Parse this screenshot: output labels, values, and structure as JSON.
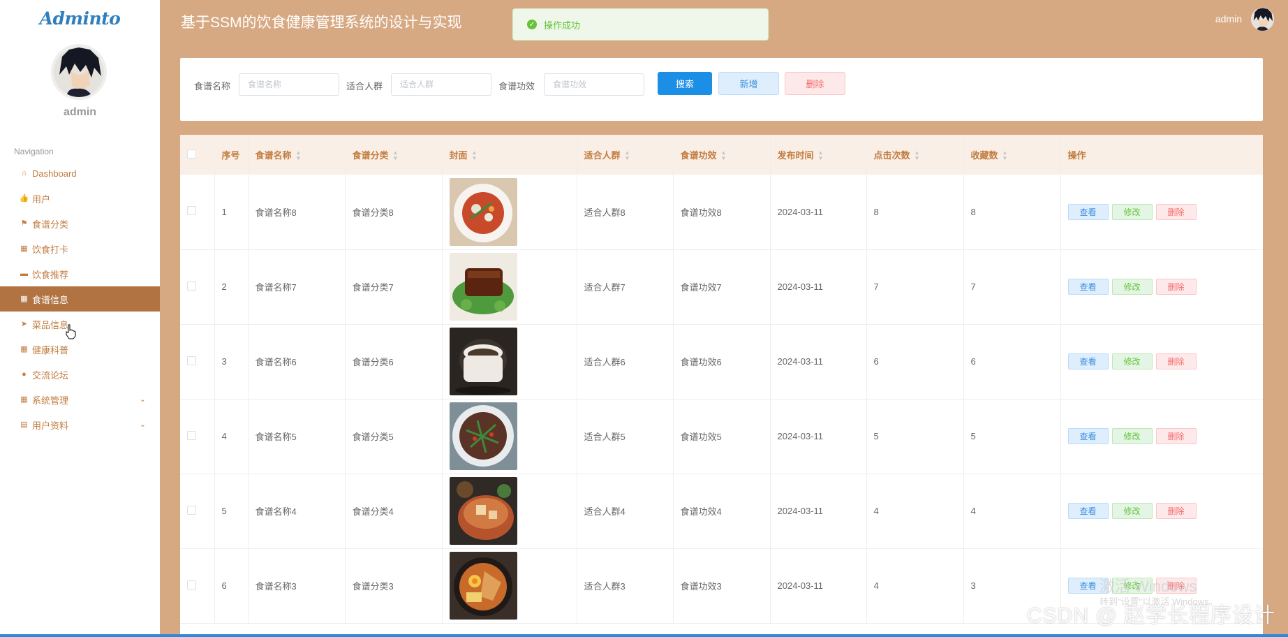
{
  "app": {
    "logo": "Adminto",
    "title": "基于SSM的饮食健康管理系统的设计与实现"
  },
  "sidebar": {
    "username": "admin",
    "nav_title": "Navigation",
    "items": [
      {
        "label": "Dashboard",
        "icon": "home-icon"
      },
      {
        "label": "用户",
        "icon": "thumbs-up-icon"
      },
      {
        "label": "食谱分类",
        "icon": "flag-icon"
      },
      {
        "label": "饮食打卡",
        "icon": "grid-icon"
      },
      {
        "label": "饮食推荐",
        "icon": "comment-icon"
      },
      {
        "label": "食谱信息",
        "icon": "grid-icon"
      },
      {
        "label": "菜品信息",
        "icon": "send-icon"
      },
      {
        "label": "健康科普",
        "icon": "grid-icon"
      },
      {
        "label": "交流论坛",
        "icon": "map-pin-icon"
      },
      {
        "label": "系统管理",
        "icon": "grid-icon"
      },
      {
        "label": "用户资料",
        "icon": "calendar-icon"
      }
    ],
    "active_index": 5
  },
  "toast": {
    "message": "操作成功"
  },
  "topbar": {
    "username": "admin"
  },
  "search": {
    "name_label": "食谱名称",
    "name_placeholder": "食谱名称",
    "crowd_label": "适合人群",
    "crowd_placeholder": "适合人群",
    "effect_label": "食谱功效",
    "effect_placeholder": "食谱功效",
    "search_btn": "搜索",
    "add_btn": "新增",
    "delete_btn": "删除"
  },
  "table": {
    "headers": [
      "序号",
      "食谱名称",
      "食谱分类",
      "封面",
      "适合人群",
      "食谱功效",
      "发布时间",
      "点击次数",
      "收藏数",
      "操作"
    ],
    "actions": {
      "view": "查看",
      "edit": "修改",
      "delete": "删除"
    },
    "rows": [
      {
        "no": "1",
        "name": "食谱名称8",
        "category": "食谱分类8",
        "crowd": "适合人群8",
        "effect": "食谱功效8",
        "date": "2024-03-11",
        "clicks": "8",
        "favs": "8"
      },
      {
        "no": "2",
        "name": "食谱名称7",
        "category": "食谱分类7",
        "crowd": "适合人群7",
        "effect": "食谱功效7",
        "date": "2024-03-11",
        "clicks": "7",
        "favs": "7"
      },
      {
        "no": "3",
        "name": "食谱名称6",
        "category": "食谱分类6",
        "crowd": "适合人群6",
        "effect": "食谱功效6",
        "date": "2024-03-11",
        "clicks": "6",
        "favs": "6"
      },
      {
        "no": "4",
        "name": "食谱名称5",
        "category": "食谱分类5",
        "crowd": "适合人群5",
        "effect": "食谱功效5",
        "date": "2024-03-11",
        "clicks": "5",
        "favs": "5"
      },
      {
        "no": "5",
        "name": "食谱名称4",
        "category": "食谱分类4",
        "crowd": "适合人群4",
        "effect": "食谱功效4",
        "date": "2024-03-11",
        "clicks": "4",
        "favs": "4"
      },
      {
        "no": "6",
        "name": "食谱名称3",
        "category": "食谱分类3",
        "crowd": "适合人群3",
        "effect": "食谱功效3",
        "date": "2024-03-11",
        "clicks": "4",
        "favs": "3"
      }
    ]
  },
  "overlays": {
    "windows_activate": "激活 Windows",
    "windows_hint": "转到\"设置\"以激活 Windows。",
    "watermark": "CSDN @ 赵学长程序设计"
  },
  "colors": {
    "header_bg": "#d7a982",
    "sidebar_active": "#b07341",
    "accent": "#c27c3f",
    "primary": "#1b8ee6"
  }
}
